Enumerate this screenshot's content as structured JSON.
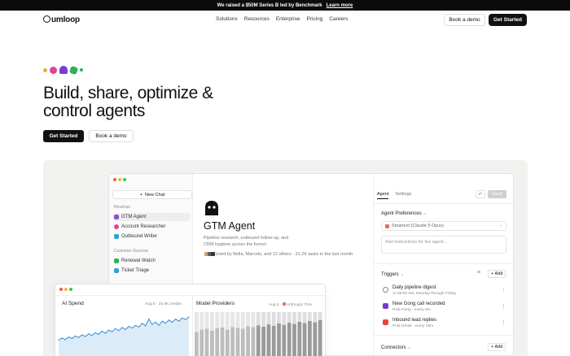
{
  "banner": {
    "text": "We raised a $50M Series B led by Benchmark",
    "link": "Learn more"
  },
  "nav": {
    "logo": "umloop",
    "links": [
      "Solutions",
      "Resources",
      "Enterprise",
      "Pricing",
      "Careers"
    ],
    "book_demo": "Book a demo",
    "get_started": "Get Started"
  },
  "hero": {
    "title": "Build, share, optimize & control agents",
    "get_started": "Get Started",
    "book_demo": "Book a demo"
  },
  "app": {
    "sidebar": {
      "new_chat": "New Chat",
      "section_revenue": "Revenue",
      "revenue_items": [
        "GTM Agent",
        "Account Researcher",
        "Outbound Writer"
      ],
      "section_cs": "Customer Success",
      "cs_items": [
        "Renewal Watch",
        "Ticket Triage"
      ]
    },
    "agent": {
      "title": "GTM Agent",
      "description": "Pipeline research, outbound follow-up, and CRM hygiene across the funnel.",
      "used_by": "Used by Bella, Marcelo, and 12 others · 31.2K tasks in the last month"
    },
    "panel": {
      "tabs": [
        "Agent",
        "Settings"
      ],
      "save": "Save",
      "prefs_header": "Agent Preferences",
      "model": "Smartest (Claude 5 Opus)",
      "instructions_placeholder": "Add instructions for the agent...",
      "triggers_header": "Triggers",
      "add": "Add",
      "triggers": [
        {
          "title": "Daily pipeline digest",
          "sub": "At 09:00 AM, Monday through Friday"
        },
        {
          "title": "New Gong call recorded",
          "sub": "Pola Gong · every 5m"
        },
        {
          "title": "Inbound lead replies",
          "sub": "Pola Gmail · every 15m"
        }
      ],
      "connectors_header": "Connectors"
    },
    "spend_card": {
      "title": "AI Spend",
      "meta": "Aug 5 · 25.8K credits",
      "providers_title": "Model Providers",
      "providers_meta": "Aug 5",
      "providers_legend": "Anthropic 75%"
    }
  },
  "colors": {
    "accent_dark": "#111111",
    "chart_line": "#3b8fd6"
  },
  "chart_data": [
    {
      "type": "area",
      "title": "AI Spend",
      "x": [
        1,
        2,
        3,
        4,
        5,
        6,
        7,
        8,
        9,
        10,
        11,
        12,
        13,
        14,
        15,
        16,
        17,
        18,
        19,
        20,
        21,
        22,
        23,
        24,
        25,
        26,
        27,
        28,
        29,
        30,
        31,
        32,
        33,
        34,
        35,
        36,
        37,
        38,
        39,
        40
      ],
      "y": [
        30,
        34,
        31,
        36,
        33,
        38,
        35,
        40,
        37,
        42,
        39,
        44,
        41,
        47,
        43,
        49,
        46,
        52,
        48,
        54,
        50,
        56,
        53,
        58,
        55,
        62,
        57,
        70,
        60,
        64,
        58,
        66,
        62,
        68,
        64,
        70,
        66,
        72,
        69,
        74
      ]
    },
    {
      "type": "bar",
      "title": "Model Providers",
      "series": [
        {
          "values": [
            55,
            60,
            62,
            58,
            63,
            65,
            60,
            66,
            64,
            62,
            68,
            66,
            70,
            67,
            72,
            69,
            74,
            71,
            76,
            73,
            78,
            75,
            80,
            77,
            82
          ]
        },
        {
          "values": [
            45,
            40,
            38,
            42,
            37,
            35,
            40,
            34,
            36,
            38,
            32,
            34,
            30,
            33,
            28,
            31,
            26,
            29,
            24,
            27,
            22,
            25,
            20,
            23,
            18
          ]
        }
      ]
    }
  ]
}
